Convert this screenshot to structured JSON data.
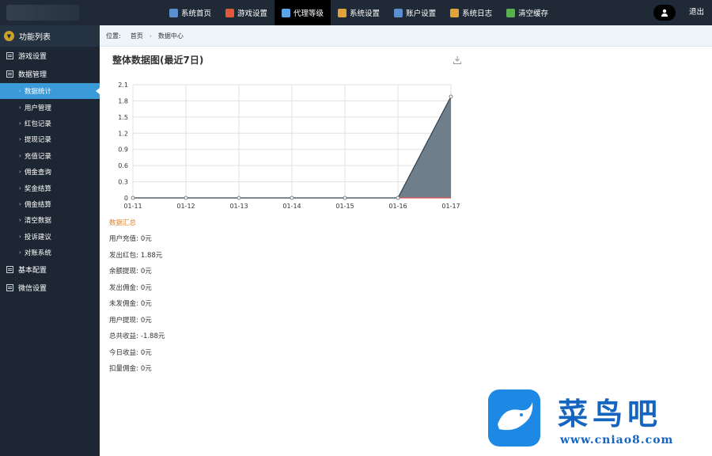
{
  "topbar": {
    "nav": [
      {
        "label": "系统首页",
        "icon": "home-icon",
        "color": "#5a8fd0",
        "active": false
      },
      {
        "label": "游戏设置",
        "icon": "game-icon",
        "color": "#e05a3a",
        "active": false
      },
      {
        "label": "代理等级",
        "icon": "agent-icon",
        "color": "#59a5e8",
        "active": true
      },
      {
        "label": "系统设置",
        "icon": "tools-icon",
        "color": "#e0a33a",
        "active": false
      },
      {
        "label": "账户设置",
        "icon": "account-icon",
        "color": "#5a8fd0",
        "active": false
      },
      {
        "label": "系统日志",
        "icon": "log-icon",
        "color": "#e0a33a",
        "active": false
      },
      {
        "label": "清空缓存",
        "icon": "clear-cache-icon",
        "color": "#5ab04e",
        "active": false
      }
    ],
    "logout": "退出"
  },
  "sidebar": {
    "header": "功能列表",
    "sections": [
      {
        "label": "游戏设置",
        "items": []
      },
      {
        "label": "数据管理",
        "items": [
          "数据统计",
          "用户管理",
          "红包记录",
          "提现记录",
          "充值记录",
          "佣金查询",
          "奖金结算",
          "佣金结算",
          "清空数据",
          "投诉建议",
          "对账系统"
        ]
      },
      {
        "label": "基本配置",
        "items": []
      },
      {
        "label": "微信设置",
        "items": []
      }
    ],
    "active_item": "数据统计"
  },
  "breadcrumb": {
    "label": "位置:",
    "items": [
      "首页",
      "数据中心"
    ]
  },
  "main": {
    "title": "整体数据图(最近7日)",
    "summary_title": "数据汇总",
    "stats": [
      {
        "label": "用户充值:",
        "value": "0元"
      },
      {
        "label": "发出红包:",
        "value": "1.88元"
      },
      {
        "label": "余额提现:",
        "value": "0元"
      },
      {
        "label": "发出佣金:",
        "value": "0元"
      },
      {
        "label": "未发佣金:",
        "value": "0元"
      },
      {
        "label": "用户提现:",
        "value": "0元"
      },
      {
        "label": "总共收益:",
        "value": "-1.88元"
      },
      {
        "label": "今日收益:",
        "value": "0元"
      },
      {
        "label": "扣量佣金:",
        "value": "0元"
      }
    ]
  },
  "chart_data": {
    "type": "area",
    "categories": [
      "01-11",
      "01-12",
      "01-13",
      "01-14",
      "01-15",
      "01-16",
      "01-17"
    ],
    "series": [
      {
        "values": [
          0,
          0,
          0,
          0,
          0,
          0,
          1.88
        ]
      }
    ],
    "ylim": [
      0,
      2.1
    ],
    "yticks": [
      "0",
      "0.3",
      "0.6",
      "0.9",
      "1.2",
      "1.5",
      "1.8",
      "2.1"
    ],
    "grid": true,
    "fill_color": "#6e7f8b",
    "line_color": "#2f4050"
  },
  "watermark": {
    "text": "菜鸟吧",
    "url": "www.cniao8.com"
  }
}
